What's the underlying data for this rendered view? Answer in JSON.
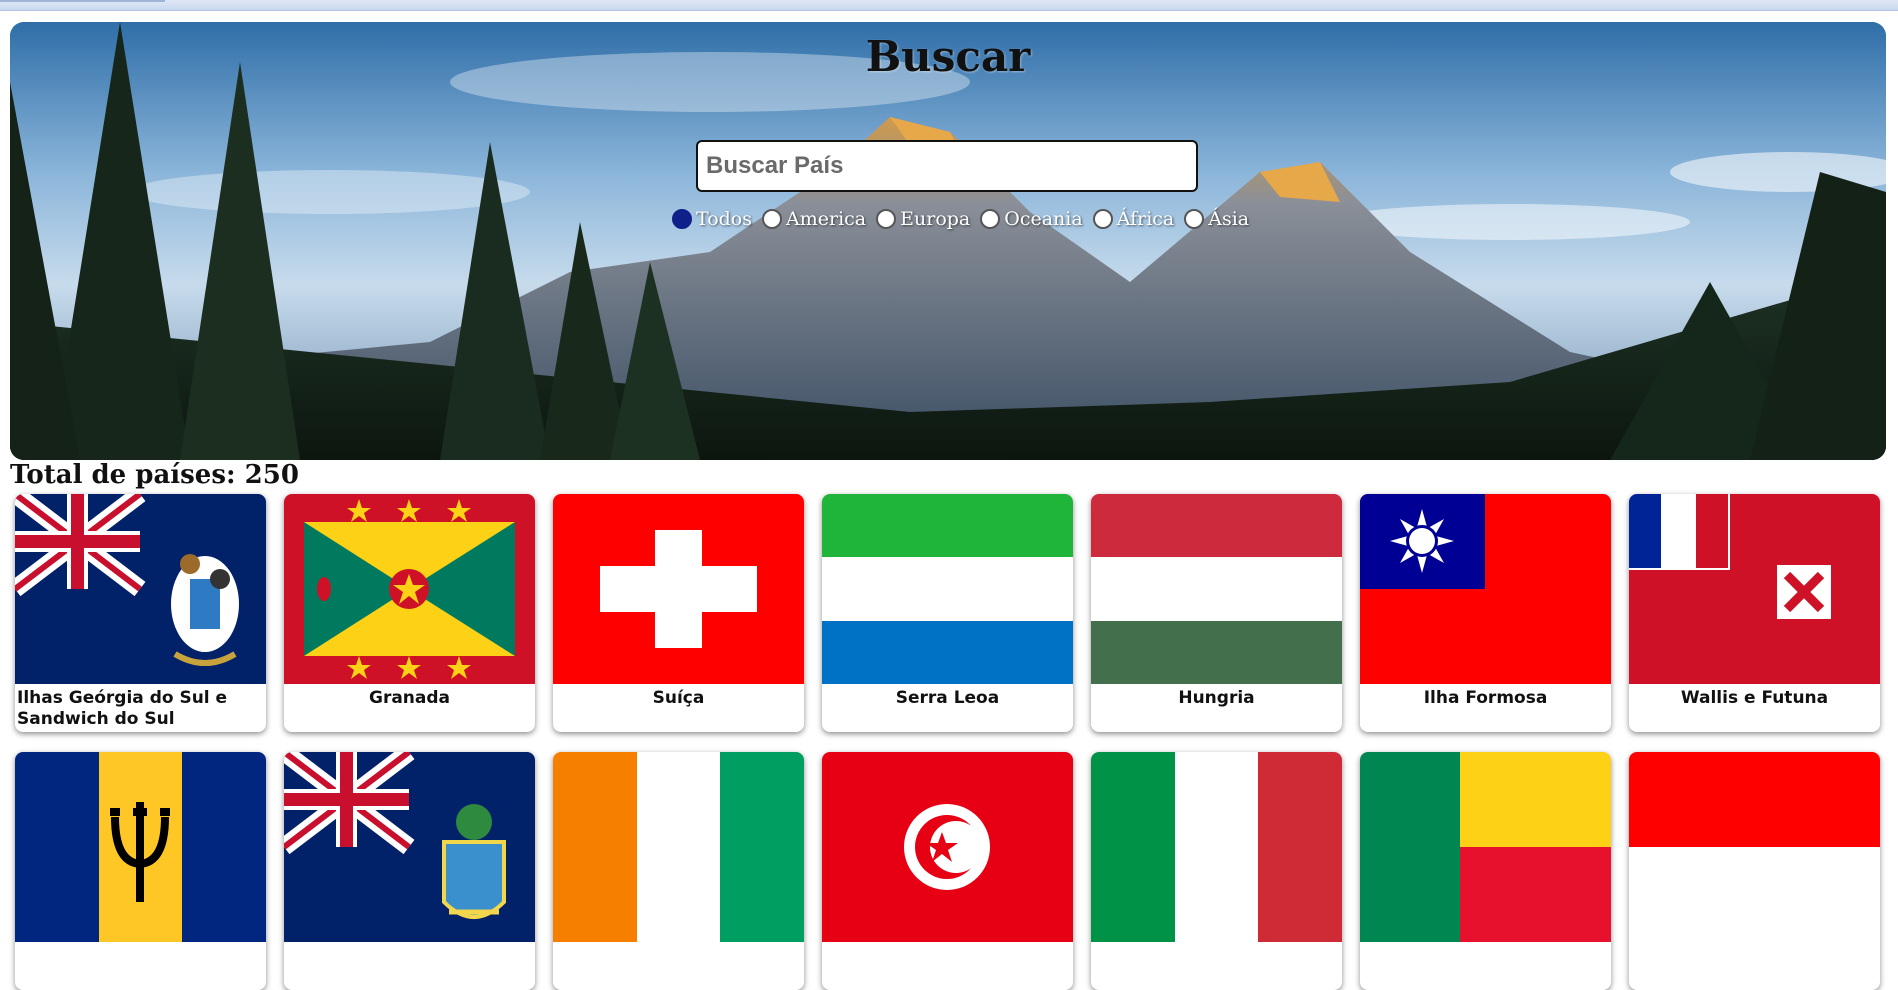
{
  "hero": {
    "title": "Buscar",
    "search_placeholder": "Buscar País",
    "filters": [
      {
        "label": "Todos",
        "checked": true
      },
      {
        "label": "America",
        "checked": false
      },
      {
        "label": "Europa",
        "checked": false
      },
      {
        "label": "Oceania",
        "checked": false
      },
      {
        "label": "África",
        "checked": false
      },
      {
        "label": "Ásia",
        "checked": false
      }
    ]
  },
  "total_label": "Total de países: 250",
  "countries": [
    {
      "name": "Ilhas Geórgia do Sul e Sandwich do Sul",
      "flag": "south-georgia-flag"
    },
    {
      "name": "Granada",
      "flag": "grenada-flag"
    },
    {
      "name": "Suíça",
      "flag": "switzerland-flag"
    },
    {
      "name": "Serra Leoa",
      "flag": "sierra-leone-flag"
    },
    {
      "name": "Hungria",
      "flag": "hungary-flag"
    },
    {
      "name": "Ilha Formosa",
      "flag": "taiwan-flag"
    },
    {
      "name": "Wallis e Futuna",
      "flag": "wallis-futuna-flag"
    },
    {
      "name": "",
      "flag": "barbados-flag"
    },
    {
      "name": "",
      "flag": "pitcairn-flag"
    },
    {
      "name": "",
      "flag": "ivory-coast-flag"
    },
    {
      "name": "",
      "flag": "tunisia-flag"
    },
    {
      "name": "",
      "flag": "italy-flag"
    },
    {
      "name": "",
      "flag": "benin-flag"
    },
    {
      "name": "",
      "flag": "indonesia-flag"
    }
  ],
  "colors": {
    "radio_checked": "#10208a",
    "card_shadow": "#00000073"
  }
}
